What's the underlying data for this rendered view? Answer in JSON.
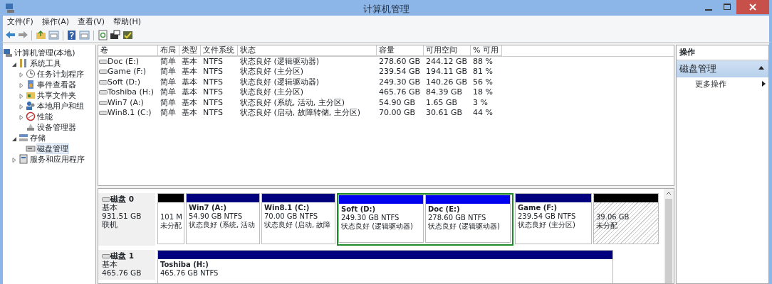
{
  "window": {
    "title": "计算机管理"
  },
  "menu": [
    "文件(F)",
    "操作(A)",
    "查看(V)",
    "帮助(H)"
  ],
  "tree": [
    {
      "label": "计算机管理(本地)",
      "selected": false,
      "children": [
        {
          "label": "系统工具",
          "selected": false,
          "expanded": true,
          "children": [
            {
              "label": "任务计划程序",
              "selected": false,
              "expanded": false
            },
            {
              "label": "事件查看器",
              "selected": false,
              "expanded": false
            },
            {
              "label": "共享文件夹",
              "selected": false,
              "expanded": false
            },
            {
              "label": "本地用户和组",
              "selected": false,
              "expanded": false
            },
            {
              "label": "性能",
              "selected": false,
              "expanded": false
            },
            {
              "label": "设备管理器",
              "selected": false
            }
          ]
        },
        {
          "label": "存储",
          "selected": false,
          "expanded": true,
          "children": [
            {
              "label": "磁盘管理",
              "selected": true
            }
          ]
        },
        {
          "label": "服务和应用程序",
          "selected": false,
          "expanded": false
        }
      ]
    }
  ],
  "table": {
    "columns": [
      "卷",
      "布局",
      "类型",
      "文件系统",
      "状态",
      "容量",
      "可用空间",
      "% 可用"
    ],
    "rows": [
      [
        "Doc (E:)",
        "简单",
        "基本",
        "NTFS",
        "状态良好 (逻辑驱动器)",
        "278.60 GB",
        "244.12 GB",
        "88 %"
      ],
      [
        "Game (F:)",
        "简单",
        "基本",
        "NTFS",
        "状态良好 (主分区)",
        "239.54 GB",
        "194.11 GB",
        "81 %"
      ],
      [
        "Soft (D:)",
        "简单",
        "基本",
        "NTFS",
        "状态良好 (逻辑驱动器)",
        "249.30 GB",
        "140.26 GB",
        "56 %"
      ],
      [
        "Toshiba (H:)",
        "简单",
        "基本",
        "NTFS",
        "状态良好 (主分区)",
        "465.76 GB",
        "84.39 GB",
        "18 %"
      ],
      [
        "Win7 (A:)",
        "简单",
        "基本",
        "NTFS",
        "状态良好 (系统, 活动, 主分区)",
        "54.90 GB",
        "1.65 GB",
        "3 %"
      ],
      [
        "Win8.1 (C:)",
        "简单",
        "基本",
        "NTFS",
        "状态良好 (启动, 故障转储, 主分区)",
        "70.00 GB",
        "30.61 GB",
        "44 %"
      ]
    ]
  },
  "disks": [
    {
      "name": "磁盘 0",
      "type": "基本",
      "size": "931.51 GB",
      "status": "联机",
      "partitions": [
        {
          "kind": "unallocated",
          "size": "101 M",
          "status": "未分配"
        },
        {
          "kind": "primary",
          "label": "Win7  (A:)",
          "size": "54.90 GB NTFS",
          "status": "状态良好 (系统, 活动"
        },
        {
          "kind": "primary",
          "label": "Win8.1  (C:)",
          "size": "70.00 GB NTFS",
          "status": "状态良好 (启动, 故障"
        },
        {
          "kind": "logical",
          "label": "Soft  (D:)",
          "size": "249.30 GB NTFS",
          "status": "状态良好 (逻辑驱动器)"
        },
        {
          "kind": "logical",
          "label": "Doc  (E:)",
          "size": "278.60 GB NTFS",
          "status": "状态良好 (逻辑驱动器)"
        },
        {
          "kind": "primary",
          "label": "Game  (F:)",
          "size": "239.54 GB NTFS",
          "status": "状态良好 (主分区)"
        },
        {
          "kind": "unallocated",
          "size": "39.06 GB",
          "status": "未分配"
        }
      ]
    },
    {
      "name": "磁盘 1",
      "type": "基本",
      "size": "465.76 GB",
      "partitions": [
        {
          "kind": "primary",
          "label": "Toshiba  (H:)",
          "size": "465.76 GB NTFS"
        }
      ]
    }
  ],
  "actions": {
    "header": "操作",
    "section": {
      "title": "磁盘管理",
      "expanded": true
    },
    "items": [
      {
        "label": "更多操作"
      }
    ]
  }
}
